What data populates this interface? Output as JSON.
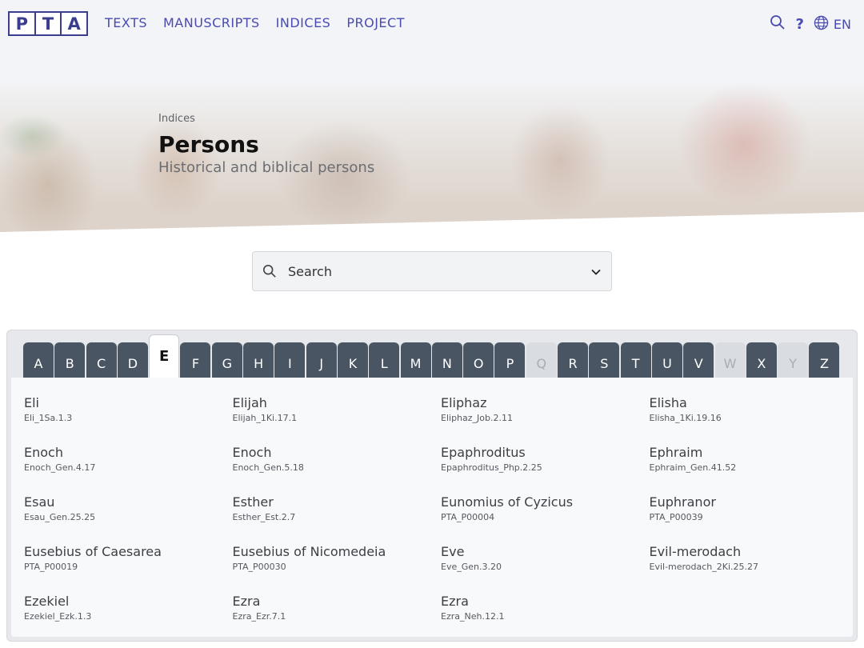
{
  "header": {
    "logo_letters": [
      "P",
      "T",
      "A"
    ],
    "nav": [
      "TEXTS",
      "MANUSCRIPTS",
      "INDICES",
      "PROJECT"
    ],
    "help": "?",
    "language": "EN"
  },
  "hero": {
    "breadcrumb": "Indices",
    "title": "Persons",
    "subtitle": "Historical and biblical persons"
  },
  "search": {
    "placeholder": "Search"
  },
  "alphabet": {
    "letters": [
      "A",
      "B",
      "C",
      "D",
      "E",
      "F",
      "G",
      "H",
      "I",
      "J",
      "K",
      "L",
      "M",
      "N",
      "O",
      "P",
      "Q",
      "R",
      "S",
      "T",
      "U",
      "V",
      "W",
      "X",
      "Y",
      "Z"
    ],
    "active": "E",
    "disabled": [
      "Q",
      "W",
      "Y"
    ]
  },
  "entries": [
    {
      "name": "Eli",
      "ref": "Eli_1Sa.1.3"
    },
    {
      "name": "Elijah",
      "ref": "Elijah_1Ki.17.1"
    },
    {
      "name": "Eliphaz",
      "ref": "Eliphaz_Job.2.11"
    },
    {
      "name": "Elisha",
      "ref": "Elisha_1Ki.19.16"
    },
    {
      "name": "Enoch",
      "ref": "Enoch_Gen.4.17"
    },
    {
      "name": "Enoch",
      "ref": "Enoch_Gen.5.18"
    },
    {
      "name": "Epaphroditus",
      "ref": "Epaphroditus_Php.2.25"
    },
    {
      "name": "Ephraim",
      "ref": "Ephraim_Gen.41.52"
    },
    {
      "name": "Esau",
      "ref": "Esau_Gen.25.25"
    },
    {
      "name": "Esther",
      "ref": "Esther_Est.2.7"
    },
    {
      "name": "Eunomius of Cyzicus",
      "ref": "PTA_P00004"
    },
    {
      "name": "Euphranor",
      "ref": "PTA_P00039"
    },
    {
      "name": "Eusebius of Caesarea",
      "ref": "PTA_P00019"
    },
    {
      "name": "Eusebius of Nicomedeia",
      "ref": "PTA_P00030"
    },
    {
      "name": "Eve",
      "ref": "Eve_Gen.3.20"
    },
    {
      "name": "Evil-merodach",
      "ref": "Evil-merodach_2Ki.25.27"
    },
    {
      "name": "Ezekiel",
      "ref": "Ezekiel_Ezk.1.3"
    },
    {
      "name": "Ezra",
      "ref": "Ezra_Ezr.7.1"
    },
    {
      "name": "Ezra",
      "ref": "Ezra_Neh.12.1"
    }
  ],
  "colors": {
    "brand": "#3b3d8f",
    "nav": "#4a4bb0",
    "tab": "#4a5563",
    "tab_disabled": "#d9dce0"
  },
  "icons": [
    "search-icon",
    "help-icon",
    "globe-icon",
    "chevron-down-icon"
  ]
}
